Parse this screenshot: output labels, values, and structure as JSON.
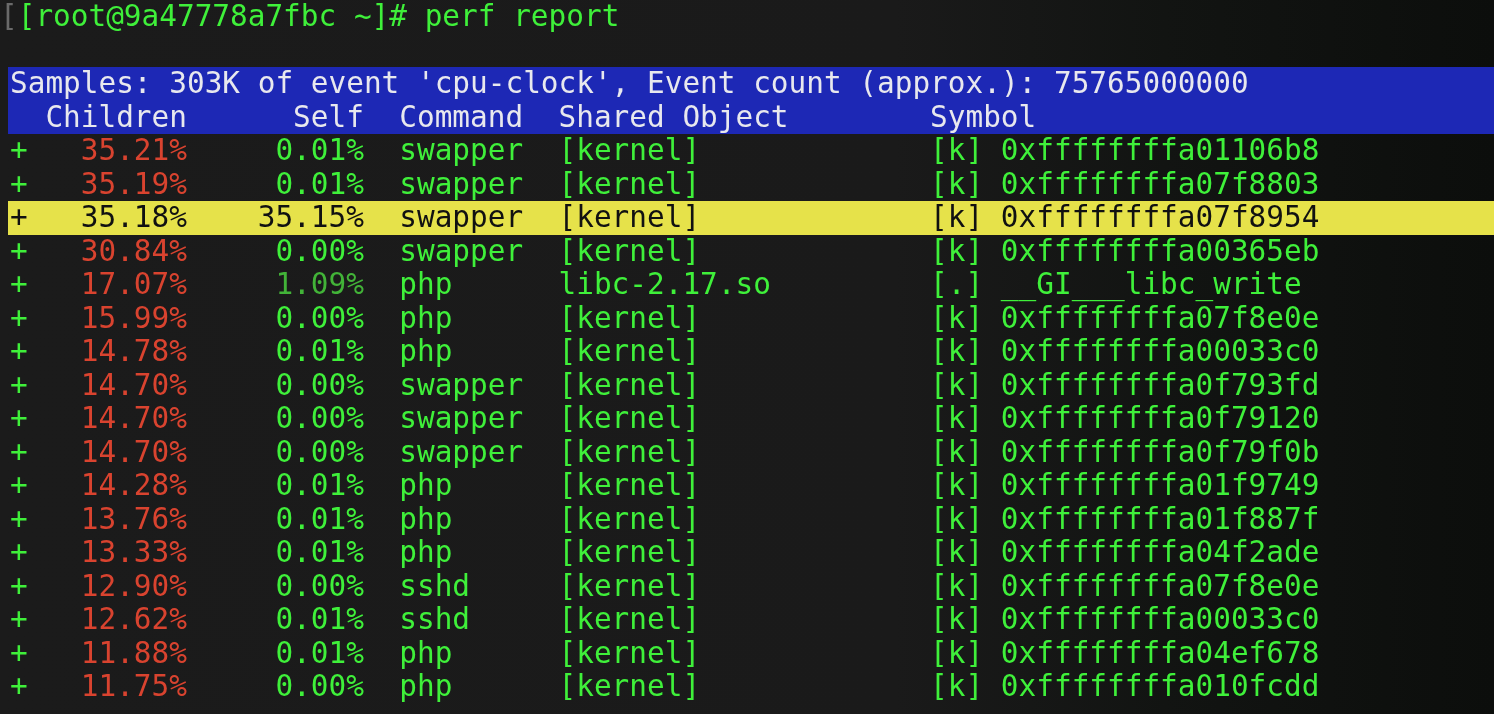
{
  "terminal": {
    "prompt_fragment": "[",
    "prompt": "[root@9a47778a7fbc ~]# perf report"
  },
  "report": {
    "summary": "Samples: 303K of event 'cpu-clock', Event count (approx.): 75765000000",
    "columns": [
      "Children",
      "Self",
      "Command",
      "Shared Object",
      "Symbol"
    ],
    "rows": [
      {
        "marker": "+",
        "children": {
          "text": "35.21%",
          "color": "#d9432f"
        },
        "self": {
          "text": "0.01%",
          "color": "#3ff03a"
        },
        "command": "swapper",
        "shared_object": "[kernel]",
        "symbol_type": "[k]",
        "symbol": "0xffffffffa01106b8",
        "selected": false
      },
      {
        "marker": "+",
        "children": {
          "text": "35.19%",
          "color": "#d9432f"
        },
        "self": {
          "text": "0.01%",
          "color": "#3ff03a"
        },
        "command": "swapper",
        "shared_object": "[kernel]",
        "symbol_type": "[k]",
        "symbol": "0xffffffffa07f8803",
        "selected": false
      },
      {
        "marker": "+",
        "children": {
          "text": "35.18%"
        },
        "self": {
          "text": "35.15%"
        },
        "command": "swapper",
        "shared_object": "[kernel]",
        "symbol_type": "[k]",
        "symbol": "0xffffffffa07f8954",
        "selected": true
      },
      {
        "marker": "+",
        "children": {
          "text": "30.84%",
          "color": "#d9432f"
        },
        "self": {
          "text": "0.00%",
          "color": "#3ff03a"
        },
        "command": "swapper",
        "shared_object": "[kernel]",
        "symbol_type": "[k]",
        "symbol": "0xffffffffa00365eb",
        "selected": false
      },
      {
        "marker": "+",
        "children": {
          "text": "17.07%",
          "color": "#d9432f"
        },
        "self": {
          "text": "1.09%",
          "color": "#42b338"
        },
        "command": "php",
        "shared_object": "libc-2.17.so",
        "symbol_type": "[.]",
        "symbol": "__GI___libc_write",
        "selected": false
      },
      {
        "marker": "+",
        "children": {
          "text": "15.99%",
          "color": "#d9432f"
        },
        "self": {
          "text": "0.00%",
          "color": "#3ff03a"
        },
        "command": "php",
        "shared_object": "[kernel]",
        "symbol_type": "[k]",
        "symbol": "0xffffffffa07f8e0e",
        "selected": false
      },
      {
        "marker": "+",
        "children": {
          "text": "14.78%",
          "color": "#d9432f"
        },
        "self": {
          "text": "0.01%",
          "color": "#3ff03a"
        },
        "command": "php",
        "shared_object": "[kernel]",
        "symbol_type": "[k]",
        "symbol": "0xffffffffa00033c0",
        "selected": false
      },
      {
        "marker": "+",
        "children": {
          "text": "14.70%",
          "color": "#d9432f"
        },
        "self": {
          "text": "0.00%",
          "color": "#3ff03a"
        },
        "command": "swapper",
        "shared_object": "[kernel]",
        "symbol_type": "[k]",
        "symbol": "0xffffffffa0f793fd",
        "selected": false
      },
      {
        "marker": "+",
        "children": {
          "text": "14.70%",
          "color": "#d9432f"
        },
        "self": {
          "text": "0.00%",
          "color": "#3ff03a"
        },
        "command": "swapper",
        "shared_object": "[kernel]",
        "symbol_type": "[k]",
        "symbol": "0xffffffffa0f79120",
        "selected": false
      },
      {
        "marker": "+",
        "children": {
          "text": "14.70%",
          "color": "#d9432f"
        },
        "self": {
          "text": "0.00%",
          "color": "#3ff03a"
        },
        "command": "swapper",
        "shared_object": "[kernel]",
        "symbol_type": "[k]",
        "symbol": "0xffffffffa0f79f0b",
        "selected": false
      },
      {
        "marker": "+",
        "children": {
          "text": "14.28%",
          "color": "#d9432f"
        },
        "self": {
          "text": "0.01%",
          "color": "#3ff03a"
        },
        "command": "php",
        "shared_object": "[kernel]",
        "symbol_type": "[k]",
        "symbol": "0xffffffffa01f9749",
        "selected": false
      },
      {
        "marker": "+",
        "children": {
          "text": "13.76%",
          "color": "#d9432f"
        },
        "self": {
          "text": "0.01%",
          "color": "#3ff03a"
        },
        "command": "php",
        "shared_object": "[kernel]",
        "symbol_type": "[k]",
        "symbol": "0xffffffffa01f887f",
        "selected": false
      },
      {
        "marker": "+",
        "children": {
          "text": "13.33%",
          "color": "#d9432f"
        },
        "self": {
          "text": "0.01%",
          "color": "#3ff03a"
        },
        "command": "php",
        "shared_object": "[kernel]",
        "symbol_type": "[k]",
        "symbol": "0xffffffffa04f2ade",
        "selected": false
      },
      {
        "marker": "+",
        "children": {
          "text": "12.90%",
          "color": "#d9432f"
        },
        "self": {
          "text": "0.00%",
          "color": "#3ff03a"
        },
        "command": "sshd",
        "shared_object": "[kernel]",
        "symbol_type": "[k]",
        "symbol": "0xffffffffa07f8e0e",
        "selected": false
      },
      {
        "marker": "+",
        "children": {
          "text": "12.62%",
          "color": "#d9432f"
        },
        "self": {
          "text": "0.01%",
          "color": "#3ff03a"
        },
        "command": "sshd",
        "shared_object": "[kernel]",
        "symbol_type": "[k]",
        "symbol": "0xffffffffa00033c0",
        "selected": false
      },
      {
        "marker": "+",
        "children": {
          "text": "11.88%",
          "color": "#d9432f"
        },
        "self": {
          "text": "0.01%",
          "color": "#3ff03a"
        },
        "command": "php",
        "shared_object": "[kernel]",
        "symbol_type": "[k]",
        "symbol": "0xffffffffa04ef678",
        "selected": false
      },
      {
        "marker": "+",
        "children": {
          "text": "11.75%",
          "color": "#d9432f"
        },
        "self": {
          "text": "0.00%",
          "color": "#3ff03a"
        },
        "command": "php",
        "shared_object": "[kernel]",
        "symbol_type": "[k]",
        "symbol": "0xffffffffa010fcdd",
        "selected": false
      }
    ]
  }
}
